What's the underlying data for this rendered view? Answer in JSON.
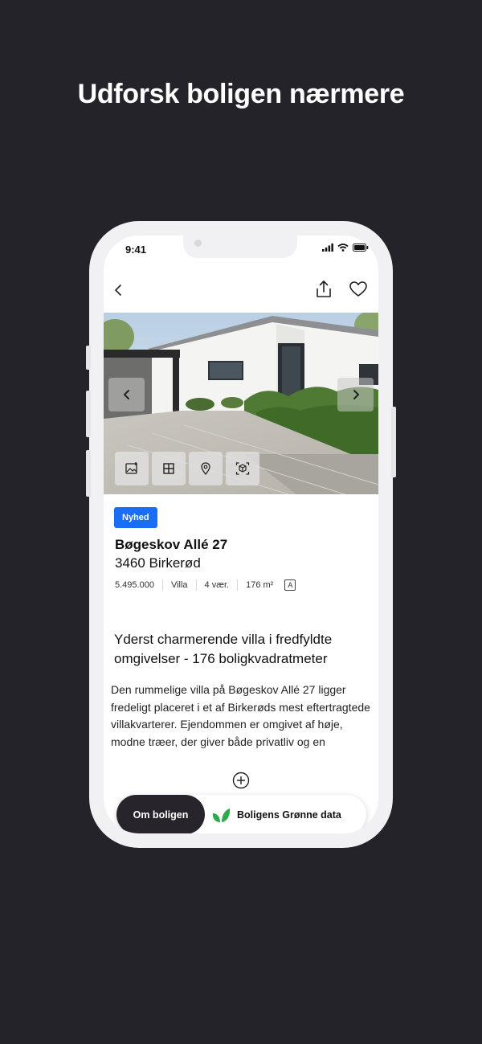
{
  "headline": "Udforsk boligen nærmere",
  "status_bar": {
    "time": "9:41"
  },
  "listing": {
    "badge": "Nyhed",
    "address": "Bøgeskov Allé 27",
    "city": "3460 Birkerød",
    "facts": [
      "5.495.000",
      "Villa",
      "4 vær.",
      "176 m²"
    ],
    "energy_label": "A",
    "description_title": "Yderst charmerende villa i fredfyldte omgivelser - 176 boligkvadratmeter",
    "description_body": "Den rummelige villa på Bøgeskov Allé 27 ligger fredeligt placeret i et af Birkerøds mest eftertragtede villakvarterer. Ejendommen er omgivet af høje, modne træer, der giver både privatliv og en"
  },
  "tabs": {
    "active": "Om boligen",
    "green": "Boligens Grønne data"
  },
  "colors": {
    "background": "#25232a",
    "badge": "#1a6ef5",
    "active_tab": "#27252b",
    "leaf": "#2eaa4a"
  },
  "icons": [
    "back-icon",
    "share-icon",
    "heart-icon",
    "chevron-left-icon",
    "chevron-right-icon",
    "add-photo-icon",
    "floorplan-icon",
    "map-pin-icon",
    "360-view-icon",
    "plus-circle-icon",
    "leaf-icon"
  ]
}
